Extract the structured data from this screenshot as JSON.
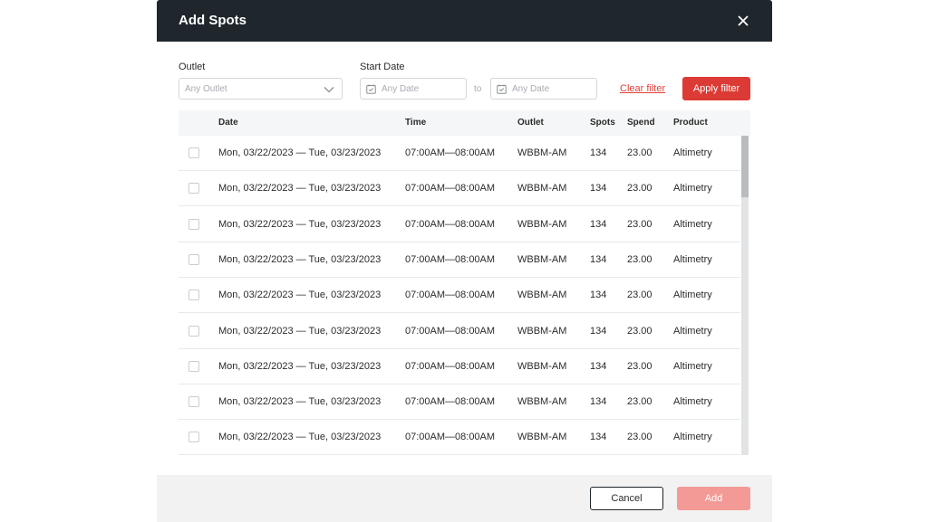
{
  "modal": {
    "title": "Add Spots",
    "header_color": "#1f262c"
  },
  "filters": {
    "outlet_label": "Outlet",
    "outlet_value": "Any Outlet",
    "start_date_label": "Start Date",
    "date_from": "Any Date",
    "to_text": "to",
    "date_to": "Any Date",
    "clear_label": "Clear filter",
    "apply_label": "Apply filter",
    "accent_color": "#dc3b35"
  },
  "table": {
    "headers": {
      "date": "Date",
      "time": "Time",
      "outlet": "Outlet",
      "spots": "Spots",
      "spend": "Spend",
      "product": "Product"
    },
    "rows": [
      {
        "date": "Mon, 03/22/2023 — Tue, 03/23/2023",
        "time": "07:00AM—08:00AM",
        "outlet": "WBBM-AM",
        "spots": "134",
        "spend": "23.00",
        "product": "Altimetry"
      },
      {
        "date": "Mon, 03/22/2023 — Tue, 03/23/2023",
        "time": "07:00AM—08:00AM",
        "outlet": "WBBM-AM",
        "spots": "134",
        "spend": "23.00",
        "product": "Altimetry"
      },
      {
        "date": "Mon, 03/22/2023 — Tue, 03/23/2023",
        "time": "07:00AM—08:00AM",
        "outlet": "WBBM-AM",
        "spots": "134",
        "spend": "23.00",
        "product": "Altimetry"
      },
      {
        "date": "Mon, 03/22/2023 — Tue, 03/23/2023",
        "time": "07:00AM—08:00AM",
        "outlet": "WBBM-AM",
        "spots": "134",
        "spend": "23.00",
        "product": "Altimetry"
      },
      {
        "date": "Mon, 03/22/2023 — Tue, 03/23/2023",
        "time": "07:00AM—08:00AM",
        "outlet": "WBBM-AM",
        "spots": "134",
        "spend": "23.00",
        "product": "Altimetry"
      },
      {
        "date": "Mon, 03/22/2023 — Tue, 03/23/2023",
        "time": "07:00AM—08:00AM",
        "outlet": "WBBM-AM",
        "spots": "134",
        "spend": "23.00",
        "product": "Altimetry"
      },
      {
        "date": "Mon, 03/22/2023 — Tue, 03/23/2023",
        "time": "07:00AM—08:00AM",
        "outlet": "WBBM-AM",
        "spots": "134",
        "spend": "23.00",
        "product": "Altimetry"
      },
      {
        "date": "Mon, 03/22/2023 — Tue, 03/23/2023",
        "time": "07:00AM—08:00AM",
        "outlet": "WBBM-AM",
        "spots": "134",
        "spend": "23.00",
        "product": "Altimetry"
      },
      {
        "date": "Mon, 03/22/2023 — Tue, 03/23/2023",
        "time": "07:00AM—08:00AM",
        "outlet": "WBBM-AM",
        "spots": "134",
        "spend": "23.00",
        "product": "Altimetry"
      }
    ]
  },
  "footer": {
    "cancel_label": "Cancel",
    "add_label": "Add",
    "add_color": "#f49a96"
  },
  "icons": {
    "close": "close-icon",
    "dropdown": "chevron-down-icon",
    "calendar": "calendar-icon"
  }
}
